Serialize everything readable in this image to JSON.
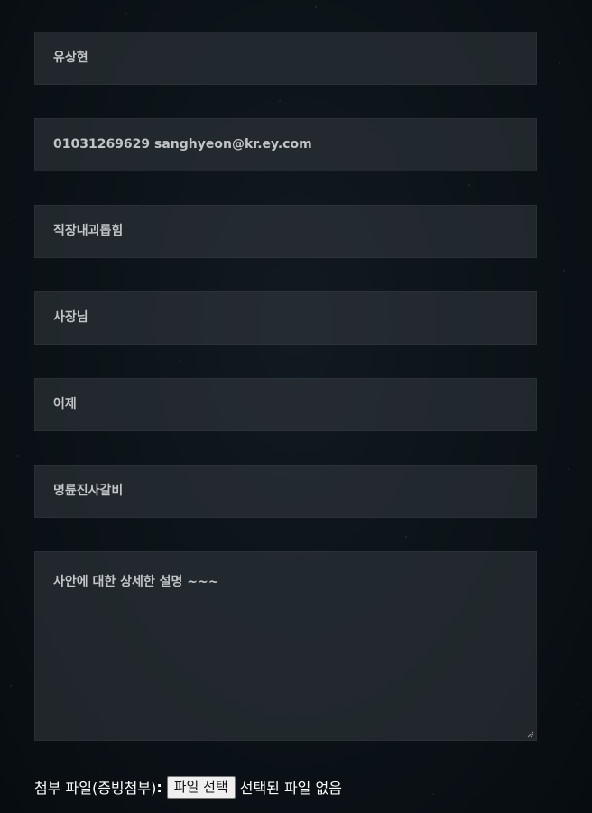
{
  "form": {
    "name_value": "유상현",
    "contact_value": "01031269629 sanghyeon@kr.ey.com",
    "type_value": "직장내괴롭힘",
    "target_value": "사장님",
    "date_value": "어제",
    "place_value": "명륜진사갈비",
    "description_value": "사안에 대한 상세한 설명 ~~~"
  },
  "attachment": {
    "label": "첨부 파일(증빙첨부)",
    "colon": ":",
    "button_label": "파일 선택",
    "status_text": "선택된 파일 없음"
  },
  "colors": {
    "field_background": "#2a3036",
    "field_text": "#c2c5c7",
    "page_background": "#0a1015"
  }
}
